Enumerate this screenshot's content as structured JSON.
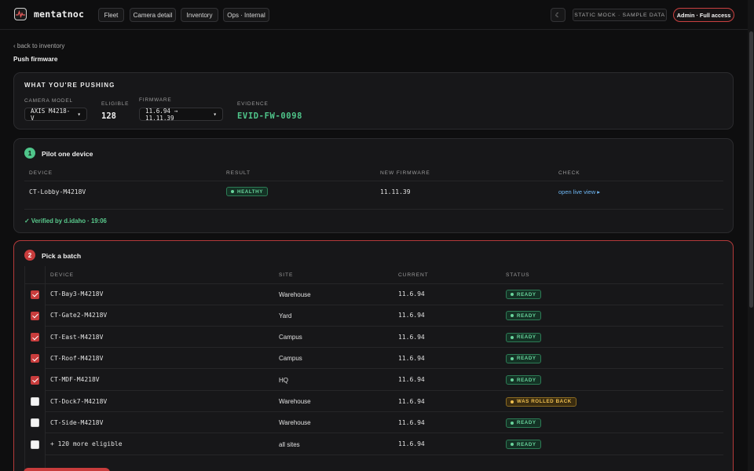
{
  "app": {
    "name": "mentatnoc"
  },
  "nav": {
    "tabs": [
      "Fleet",
      "Camera detail",
      "Inventory",
      "Ops · Internal"
    ]
  },
  "header": {
    "theme_toggle": "☾",
    "mock_badge": "STATIC MOCK · SAMPLE DATA",
    "role_badge": "Admin · Full access"
  },
  "breadcrumb": {
    "back": "‹ back to inventory"
  },
  "page": {
    "title": "Push firmware"
  },
  "push": {
    "heading": "WHAT YOU'RE PUSHING",
    "model_label": "CAMERA MODEL",
    "model_value": "AXIS M4218-V",
    "eligible_label": "ELIGIBLE",
    "eligible_value": "128",
    "firmware_label": "FIRMWARE",
    "firmware_value": "11.6.94 → 11.11.39",
    "evidence_label": "EVIDENCE",
    "evidence_value": "EVID-FW-0098",
    "caret": "▾"
  },
  "pilot": {
    "step": "1",
    "title": "Pilot one device",
    "columns": [
      "DEVICE",
      "RESULT",
      "NEW FIRMWARE",
      "CHECK"
    ],
    "device": "CT-Lobby-M4218V",
    "result": "HEALTHY",
    "new_firmware": "11.11.39",
    "check_link": "open live view ▸",
    "verified": "✓ Verified by d.idaho · 19:06"
  },
  "batch": {
    "step": "2",
    "title": "Pick a batch",
    "columns": [
      "DEVICE",
      "SITE",
      "CURRENT",
      "STATUS"
    ],
    "rows": [
      {
        "device": "CT-Bay3-M4218V",
        "site": "Warehouse",
        "current": "11.6.94",
        "status": "READY",
        "checked": true,
        "tone": "green"
      },
      {
        "device": "CT-Gate2-M4218V",
        "site": "Yard",
        "current": "11.6.94",
        "status": "READY",
        "checked": true,
        "tone": "green"
      },
      {
        "device": "CT-East-M4218V",
        "site": "Campus",
        "current": "11.6.94",
        "status": "READY",
        "checked": true,
        "tone": "green"
      },
      {
        "device": "CT-Roof-M4218V",
        "site": "Campus",
        "current": "11.6.94",
        "status": "READY",
        "checked": true,
        "tone": "green"
      },
      {
        "device": "CT-MDF-M4218V",
        "site": "HQ",
        "current": "11.6.94",
        "status": "READY",
        "checked": true,
        "tone": "green"
      },
      {
        "device": "CT-Dock7-M4218V",
        "site": "Warehouse",
        "current": "11.6.94",
        "status": "WAS ROLLED BACK",
        "checked": false,
        "tone": "amber"
      },
      {
        "device": "CT-Side-M4218V",
        "site": "Warehouse",
        "current": "11.6.94",
        "status": "READY",
        "checked": false,
        "tone": "green"
      },
      {
        "device": "+ 120 more eligible",
        "site": "all sites",
        "current": "11.6.94",
        "status": "READY",
        "checked": false,
        "tone": "green"
      }
    ]
  },
  "colors": {
    "accent_red": "#c83c3c",
    "ready_green": "#69d49c",
    "warn_amber": "#f0c050",
    "evidence_green": "#4fc58a",
    "link_blue": "#6fb8f5"
  }
}
